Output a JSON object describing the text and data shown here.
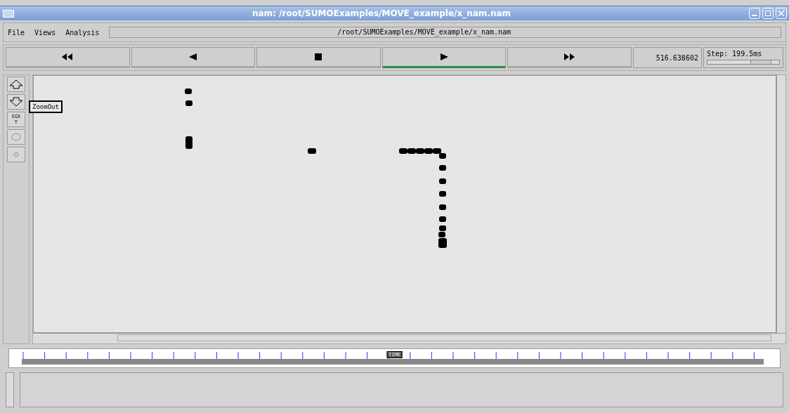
{
  "window": {
    "title": "nam: /root/SUMOExamples/MOVE_example/x_nam.nam"
  },
  "menu": [
    "File",
    "Views",
    "Analysis"
  ],
  "file_path": "/root/SUMOExamples/MOVE_example/x_nam.nam",
  "playback_buttons": [
    {
      "kind": "rewind",
      "selected": false
    },
    {
      "kind": "back",
      "selected": false
    },
    {
      "kind": "stop",
      "selected": false
    },
    {
      "kind": "play",
      "selected": true
    },
    {
      "kind": "forward",
      "selected": false
    }
  ],
  "time": "516.638602",
  "step": {
    "label": "Step: 199.5ms",
    "level": 0.75
  },
  "tools": [
    {
      "kind": "zoom-in"
    },
    {
      "kind": "zoom-out"
    },
    {
      "kind": "edit",
      "label": "EDIT"
    },
    {
      "kind": "big-circle"
    },
    {
      "kind": "small-circle"
    }
  ],
  "tooltip": "ZoomOut",
  "timeline": {
    "label": "TIME",
    "level": 0.5
  }
}
